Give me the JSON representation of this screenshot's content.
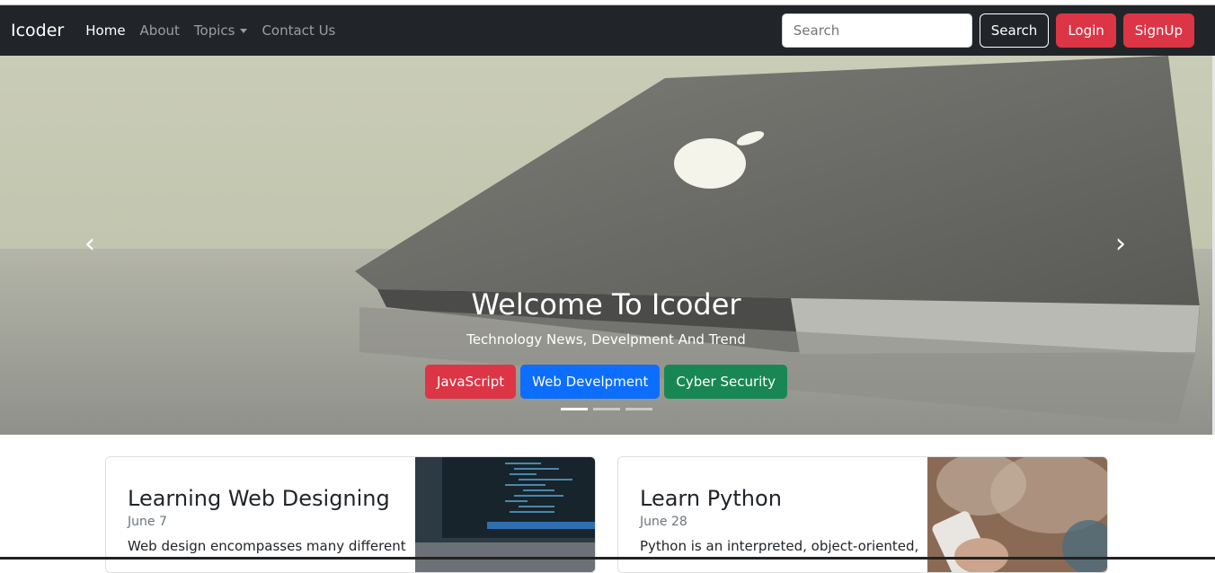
{
  "navbar": {
    "brand": "Icoder",
    "links": [
      {
        "label": "Home"
      },
      {
        "label": "About"
      },
      {
        "label": "Topics"
      },
      {
        "label": "Contact Us"
      }
    ],
    "search_placeholder": "Search",
    "search_button": "Search",
    "login": "Login",
    "signup": "SignUp"
  },
  "carousel": {
    "title": "Welcome To Icoder",
    "subtitle": "Technology News, Develpment And Trend",
    "buttons": [
      {
        "label": "JavaScript",
        "color": "#dc3545"
      },
      {
        "label": "Web Develpment",
        "color": "#0d6efd"
      },
      {
        "label": "Cyber Security",
        "color": "#198754"
      }
    ],
    "slide_count": 3,
    "active_slide": 1
  },
  "cards": [
    {
      "title": "Learning Web Designing",
      "date": "June 7",
      "text": "Web design encompasses many different"
    },
    {
      "title": "Learn Python",
      "date": "June 28",
      "text": "Python is an interpreted, object-oriented,"
    }
  ]
}
